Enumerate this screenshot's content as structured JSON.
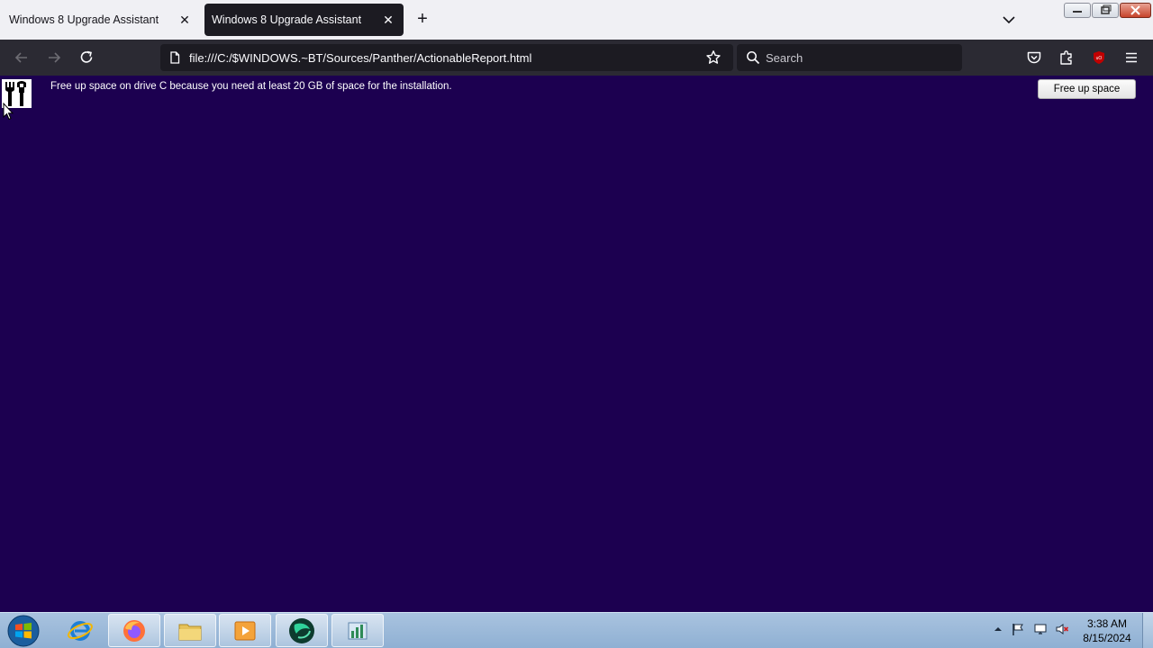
{
  "tabs": [
    {
      "label": "Windows 8 Upgrade Assistant",
      "active": false
    },
    {
      "label": "Windows 8 Upgrade Assistant",
      "active": true
    }
  ],
  "toolbar": {
    "url": "file:///C:/$WINDOWS.~BT/Sources/Panther/ActionableReport.html",
    "search_placeholder": "Search"
  },
  "content": {
    "message": "Free up space on drive C because you need at least 20 GB of space for the installation.",
    "action_label": "Free up space",
    "background_color": "#1c0050"
  },
  "taskbar": {
    "time": "3:38 AM",
    "date": "8/15/2024",
    "apps": [
      "internet-explorer",
      "firefox",
      "file-explorer",
      "media-player",
      "app-green",
      "app-chart"
    ]
  },
  "browser": {
    "accent": "#c00000"
  }
}
